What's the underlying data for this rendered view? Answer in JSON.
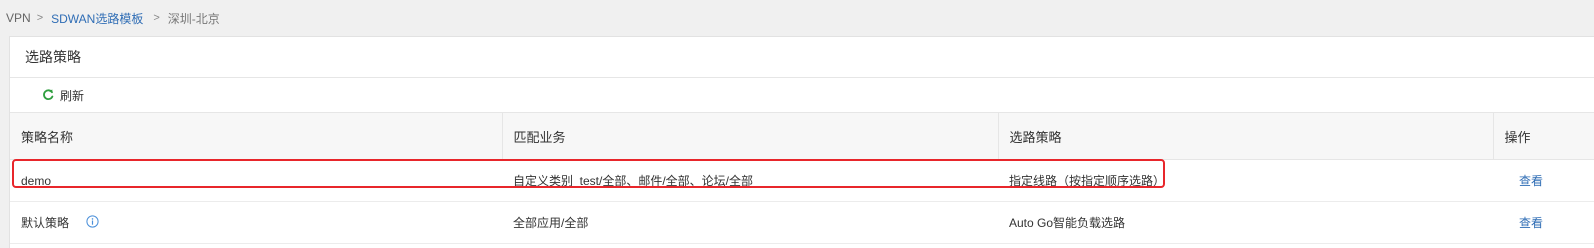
{
  "breadcrumb": {
    "root": "VPN",
    "sep1": ">",
    "template": "SDWAN选路模板",
    "sep2": ">",
    "current": "深圳-北京"
  },
  "panel": {
    "title": "选路策略"
  },
  "toolbar": {
    "refresh_label": "刷新",
    "refresh_icon": "refresh-icon"
  },
  "table": {
    "headers": [
      "策略名称",
      "匹配业务",
      "选路策略",
      "操作"
    ],
    "rows": [
      {
        "name": "demo",
        "match": "自定义类别_test/全部、邮件/全部、论坛/全部",
        "policy": "指定线路（按指定顺序选路）",
        "action": "查看"
      },
      {
        "name": "默认策略",
        "match": "全部应用/全部",
        "policy": "Auto Go智能负载选路",
        "action": "查看",
        "info_icon": "info-icon"
      }
    ]
  },
  "colors": {
    "link": "#2f6db5",
    "highlight": "#e8262b",
    "refresh_icon": "#2e9e3e"
  }
}
